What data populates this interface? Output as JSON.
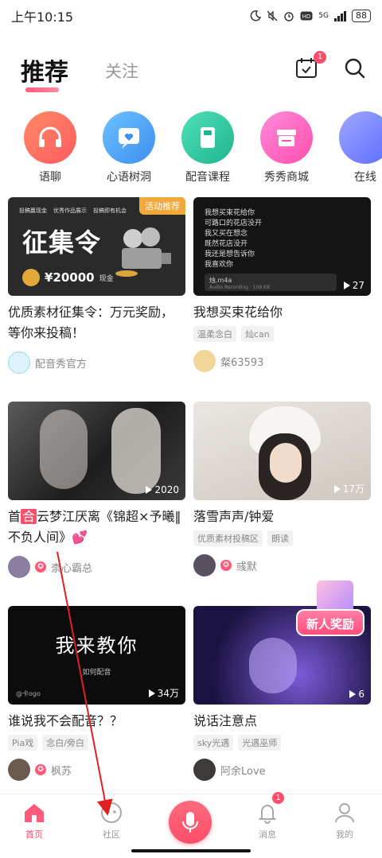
{
  "status_bar": {
    "time": "上午10:15",
    "network": "5G",
    "battery": "88"
  },
  "header": {
    "tab_recommend": "推荐",
    "tab_follow": "关注",
    "calendar_badge": "1"
  },
  "quick_entries": [
    {
      "label": "语聊",
      "icon": "headphones-icon",
      "color": "#ff6f61"
    },
    {
      "label": "心语树洞",
      "icon": "heart-chat-icon",
      "color": "#4aa8f0"
    },
    {
      "label": "配音课程",
      "icon": "book-icon",
      "color": "#2ec8a6"
    },
    {
      "label": "秀秀商城",
      "icon": "store-icon",
      "color": "#ff6fc2"
    },
    {
      "label": "在线",
      "icon": "online-icon",
      "color": "#6b7cff"
    }
  ],
  "cards": [
    {
      "thumb_badge": "活动推荐",
      "thumb_small_lines": [
        "投稿赢现金",
        "优秀作品展示",
        "投稿即有机会"
      ],
      "thumb_big": "征集令",
      "thumb_prize": "¥20000",
      "thumb_prize_unit": "现金",
      "title": "优质素材征集令：万元奖励，等你来投稿！",
      "tags": [],
      "author": "配音秀官方"
    },
    {
      "thumb_lines": [
        "我想买束花给你",
        "可路口的花店没开",
        "我又买在想念",
        "既然花店没开",
        "我还是想告诉你",
        "我喜欢你"
      ],
      "thumb_audio_name": "烛.m4a",
      "thumb_audio_sub": "Audio Recording · 109 KB",
      "plays": "27",
      "title": "我想买束花给你",
      "tags": [
        "温柔念白",
        "灿can"
      ],
      "author": "粲63593"
    },
    {
      "plays": "2020",
      "title_prefix": "首",
      "title_highlight": "合",
      "title_rest": "云梦江厌离《锦超×予曦‖不负人间》💕",
      "tags": [],
      "author": "柰心霸总"
    },
    {
      "plays": "17万",
      "title": "落雪声声/钟爱",
      "tags": [
        "优质素材投稿区",
        "朗读"
      ],
      "author": "彧默"
    },
    {
      "thumb_big": "我来教你",
      "thumb_sub": "如何配音",
      "thumb_user": "@卡ogo",
      "plays": "34万",
      "title": "谁说我不会配音？？",
      "tags": [
        "Pia戏",
        "念白/旁白"
      ],
      "author": "枫苏"
    },
    {
      "plays": "6",
      "sticker": "新人奖励",
      "title": "说话注意点",
      "tags": [
        "sky光遇",
        "光遇巫师"
      ],
      "author": "阿余Love"
    }
  ],
  "bottom_nav": {
    "home": "首页",
    "community": "社区",
    "messages": "消息",
    "mine": "我的",
    "messages_badge": "1"
  }
}
